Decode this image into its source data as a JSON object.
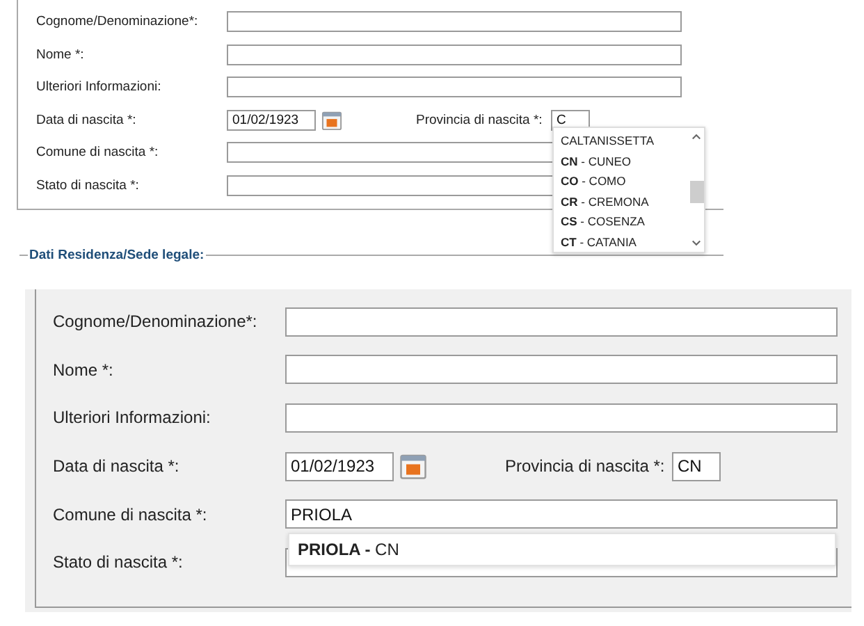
{
  "forms": [
    {
      "rows": [
        [
          {
            "label": "Cognome/Denominazione*:",
            "kind": "text"
          }
        ],
        [
          {
            "label": "Nome *:",
            "kind": "text"
          }
        ],
        [
          {
            "label": "Ulteriori Informazioni:",
            "kind": "text"
          }
        ],
        [
          {
            "label": "Data di nascita *:",
            "kind": "date",
            "value": "01/02/1923"
          },
          {
            "label": "Provincia di nascita *:",
            "kind": "short",
            "value": "C"
          }
        ],
        [
          {
            "label": "Comune di nascita *:",
            "kind": "text"
          }
        ],
        [
          {
            "label": "Stato di nascita *:",
            "kind": "text"
          }
        ]
      ],
      "suggestions": [
        "CALTANISSETTA",
        "**CN** - CUNEO",
        "**CO** - COMO",
        "**CR** - CREMONA",
        "**CS** - COSENZA",
        "**CT** - CATANIA"
      ],
      "next_section": "Dati Residenza/Sede legale:"
    },
    {
      "rows": [
        [
          {
            "label": "Cognome/Denominazione*:",
            "kind": "text"
          }
        ],
        [
          {
            "label": "Nome *:",
            "kind": "text"
          }
        ],
        [
          {
            "label": "Ulteriori Informazioni:",
            "kind": "text"
          }
        ],
        [
          {
            "label": "Data di nascita *:",
            "kind": "date",
            "value": "01/02/1923"
          },
          {
            "label": "Provincia di nascita *:",
            "kind": "short",
            "value": "CN"
          }
        ],
        [
          {
            "label": "Comune di nascita *:",
            "kind": "text",
            "value": "PRIOLA"
          }
        ],
        [
          {
            "label": "Stato di nascita *:",
            "kind": "text"
          }
        ]
      ],
      "suggestions": [
        "**PRIOLA -** CN"
      ]
    }
  ]
}
